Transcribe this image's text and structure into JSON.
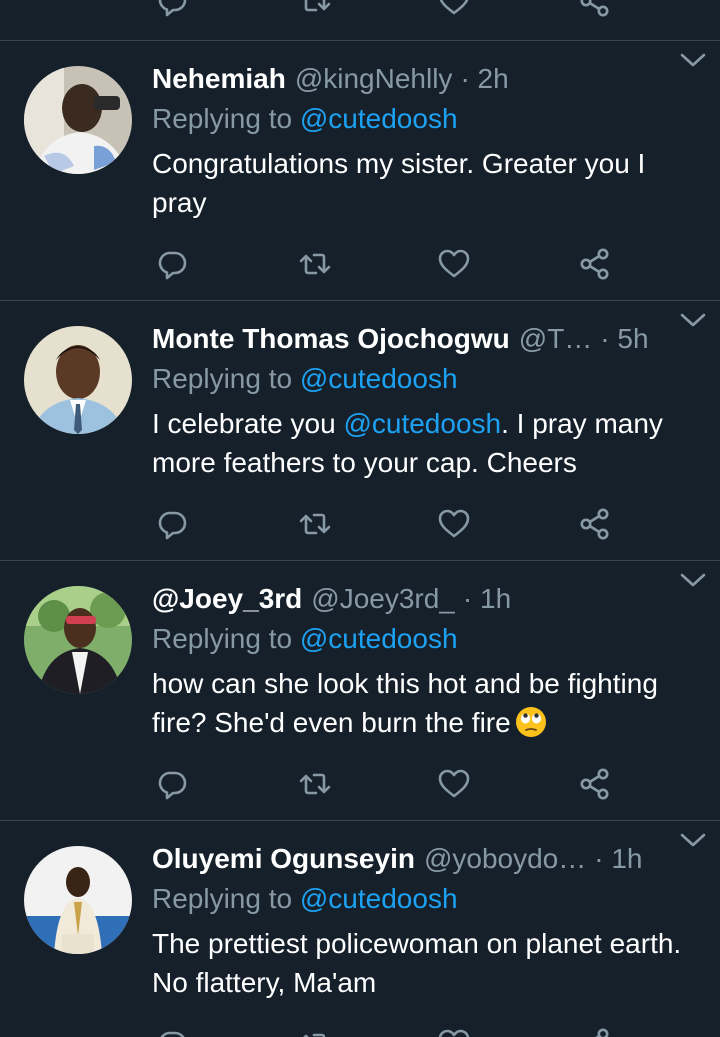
{
  "colors": {
    "background": "#15202b",
    "divider": "#38444d",
    "secondary_text": "#8899a6",
    "link": "#1da1f2",
    "primary_text": "#ffffff"
  },
  "tweets": [
    {
      "name": "Nehemiah",
      "handle": "@kingNehlly",
      "time": "· 2h",
      "replying_prefix": "Replying to ",
      "replying_to": "@cutedoosh",
      "text": "Congratulations my sister. Greater you I pray"
    },
    {
      "name": "Monte Thomas Ojochogwu",
      "handle": "@T…",
      "time": "· 5h",
      "replying_prefix": "Replying to ",
      "replying_to": "@cutedoosh",
      "text_before": "I celebrate you ",
      "text_mention": "@cutedoosh",
      "text_after": ". I pray many more feathers to your cap. Cheers"
    },
    {
      "name": "@Joey_3rd",
      "handle": "@Joey3rd_",
      "time": "· 1h",
      "replying_prefix": "Replying to ",
      "replying_to": "@cutedoosh",
      "text": "how can she look this hot and be fighting fire? She'd even burn the fire",
      "emoji": "face-with-rolling-eyes"
    },
    {
      "name": "Oluyemi Ogunseyin",
      "handle": "@yoboydo…",
      "time": "· 1h",
      "replying_prefix": "Replying to ",
      "replying_to": "@cutedoosh",
      "text": "The prettiest policewoman on planet earth. No flattery, Ma'am"
    }
  ],
  "icons": {
    "reply": "reply-icon",
    "retweet": "retweet-icon",
    "like": "heart-icon",
    "share": "share-icon",
    "menu": "chevron-down-icon"
  }
}
